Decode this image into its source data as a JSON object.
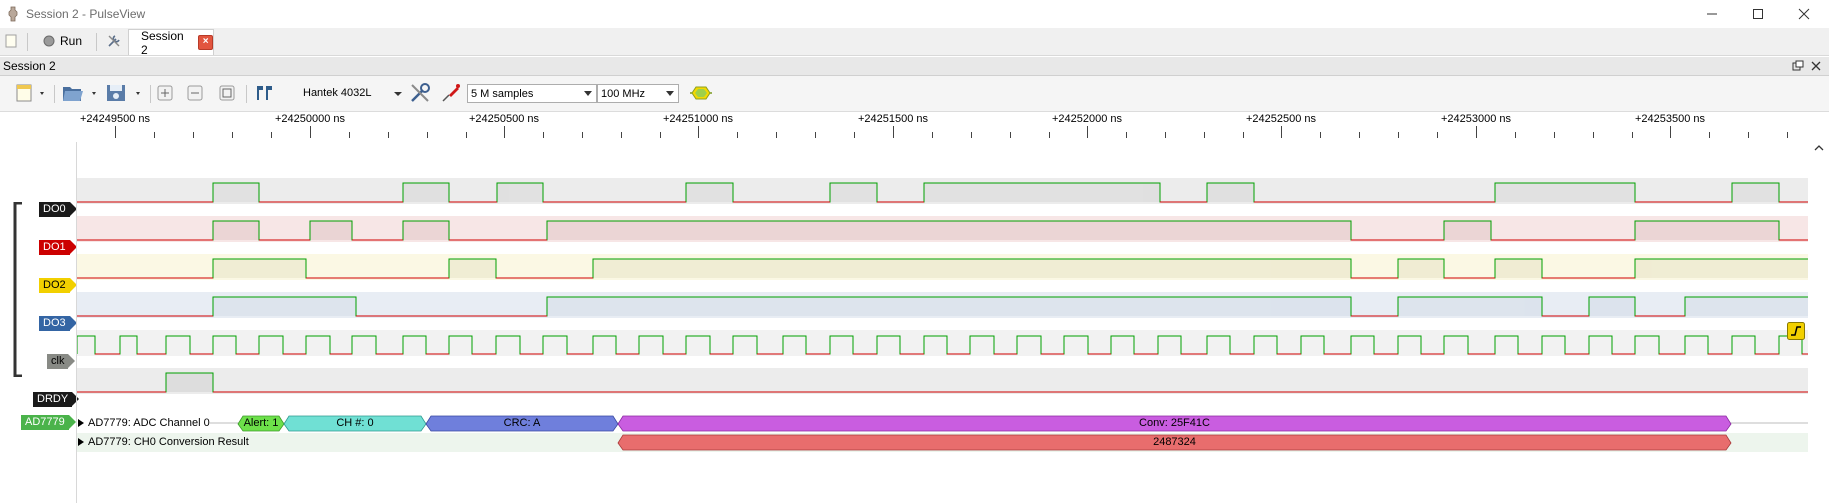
{
  "window": {
    "title": "Session 2 - PulseView",
    "controls": [
      "minimize-icon",
      "maximize-icon",
      "close-icon"
    ]
  },
  "tabbar": {
    "run_label": "Run",
    "session_tab_label": "Session 2",
    "session_tab_close": "×"
  },
  "dock": {
    "title": "Session 2"
  },
  "toolbar": {
    "device": "Hantek 4032L",
    "samples": "5 M samples",
    "samplerate": "100 MHz"
  },
  "ruler": {
    "labels": [
      "+24249500 ns",
      "+24250000 ns",
      "+24250500 ns",
      "+24251000 ns",
      "+24251500 ns",
      "+24252000 ns",
      "+24252500 ns",
      "+24253000 ns",
      "+24253500 ns"
    ]
  },
  "channels": [
    {
      "name": "DO0",
      "color": "#1a1a1a",
      "lane_bg": "#ececec"
    },
    {
      "name": "DO1",
      "color": "#cc0000",
      "lane_bg": "#f7e6e6"
    },
    {
      "name": "DO2",
      "color": "#f2d000",
      "lane_bg": "#fbf8e4"
    },
    {
      "name": "DO3",
      "color": "#3465a4",
      "lane_bg": "#e8edf4"
    },
    {
      "name": "clk",
      "color": "#888a85",
      "lane_bg": "#f2f2f2"
    },
    {
      "name": "DRDY",
      "color": "#1a1a1a",
      "lane_bg": "#ececec"
    }
  ],
  "decoder": {
    "name": "AD7779",
    "color": "#4ab34a",
    "rows": [
      {
        "label": "AD7779: ADC Channel 0"
      },
      {
        "label": "AD7779: CH0 Conversion Result"
      }
    ],
    "annotations_row0": [
      {
        "text": "Alert: 1",
        "color": "#6de04a"
      },
      {
        "text": "CH #: 0",
        "color": "#70e0d4"
      },
      {
        "text": "CRC: A",
        "color": "#6f7fdc"
      },
      {
        "text": "Conv: 25F41C",
        "color": "#c95de0"
      }
    ],
    "annotations_row1": [
      {
        "text": "2487324",
        "color": "#e86d6d"
      }
    ]
  }
}
